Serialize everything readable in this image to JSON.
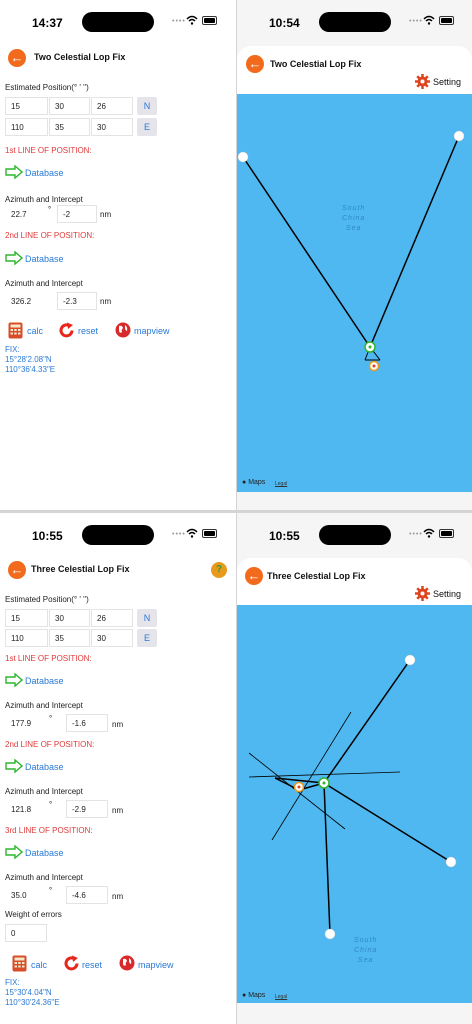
{
  "p1": {
    "time": "14:37",
    "title": "Two Celestial Lop Fix",
    "est_label": "Estimated Position(° ' '')",
    "lat": [
      "15",
      "30",
      "26"
    ],
    "lat_dir": "N",
    "lon": [
      "110",
      "35",
      "30"
    ],
    "lon_dir": "E",
    "lop1_label": "1st LINE OF POSITION:",
    "database": "Database",
    "az_label": "Azimuth and Intercept",
    "az1": "22.7",
    "int1": "-2",
    "deg": "°",
    "nm": "nm",
    "lop2_label": "2nd LINE OF POSITION:",
    "az2": "326.2",
    "int2": "-2.3",
    "calc": "calc",
    "reset": "reset",
    "mapview": "mapview",
    "fix_label": "FIX:",
    "fix_lat": "15°28'2.08\"N",
    "fix_lon": "110°36'4.33\"E"
  },
  "p2": {
    "time": "10:54",
    "title": "Two Celestial Lop Fix",
    "setting": "Setting",
    "sea": [
      "South",
      "China",
      "Sea"
    ],
    "maps": "Maps",
    "legal": "Legal"
  },
  "p3": {
    "time": "10:55",
    "title": "Three Celestial Lop Fix",
    "est_label": "Estimated Position(° ' '')",
    "lat": [
      "15",
      "30",
      "26"
    ],
    "lat_dir": "N",
    "lon": [
      "110",
      "35",
      "30"
    ],
    "lon_dir": "E",
    "lop1_label": "1st LINE OF POSITION:",
    "lop2_label": "2nd LINE OF POSITION:",
    "lop3_label": "3rd LINE OF POSITION:",
    "database": "Database",
    "az_label": "Azimuth and Intercept",
    "az1": "177.9",
    "int1": "-1.6",
    "az2": "121.8",
    "int2": "-2.9",
    "az3": "35.0",
    "int3": "-4.6",
    "deg": "°",
    "nm": "nm",
    "weight_label": "Weight of errors",
    "weight": "0",
    "calc": "calc",
    "reset": "reset",
    "mapview": "mapview",
    "fix_label": "FIX:",
    "fix_lat": "15°30'4.04\"N",
    "fix_lon": "110°30'24.36\"E",
    "help": "?"
  },
  "p4": {
    "time": "10:55",
    "title": "Three Celestial Lop Fix",
    "setting": "Setting",
    "sea": [
      "South",
      "China",
      "Sea"
    ],
    "maps": "Maps",
    "legal": "Legal"
  },
  "colors": {
    "accent": "#f26a1b",
    "link": "#2a7ad6",
    "red_label": "#e03a3a",
    "sea": "#4fb8f0"
  }
}
